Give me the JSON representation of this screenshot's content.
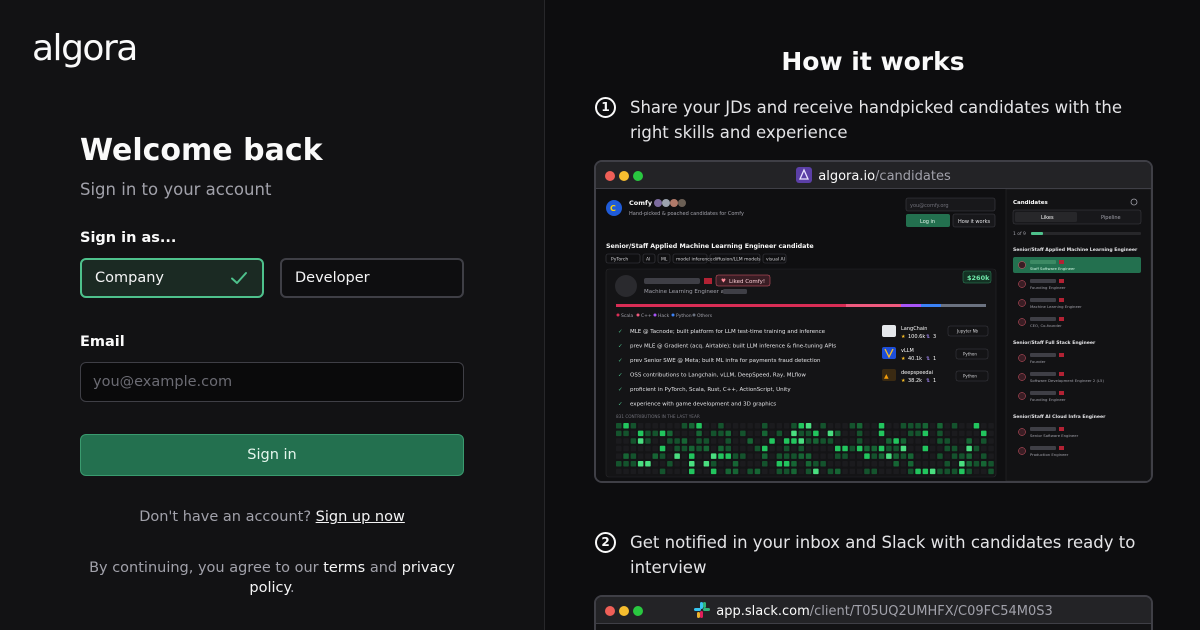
{
  "brand": {
    "logo_text": "algora"
  },
  "signin": {
    "title": "Welcome back",
    "subtitle": "Sign in to your account",
    "signin_as_label": "Sign in as...",
    "roles": [
      {
        "label": "Company",
        "selected": true
      },
      {
        "label": "Developer",
        "selected": false
      }
    ],
    "email_label": "Email",
    "email_placeholder": "you@example.com",
    "email_value": "",
    "submit_label": "Sign in",
    "no_account_text": "Don't have an account?",
    "signup_link": "Sign up now",
    "terms_prefix": "By continuing, you agree to our",
    "terms_link": "terms",
    "terms_and": "and",
    "privacy_link": "privacy policy",
    "terms_suffix": "."
  },
  "how_it_works": {
    "title": "How it works",
    "steps": [
      {
        "num": "1",
        "text": "Share your JDs and receive handpicked candidates with the right skills and experience"
      },
      {
        "num": "2",
        "text": "Get notified in your inbox and Slack with candidates ready to interview"
      }
    ],
    "browser1": {
      "url_host": "algora.io",
      "url_path": "/candidates",
      "company_name": "Comfy",
      "company_tagline": "Hand-picked & poached candidates for Comfy",
      "email_placeholder": "you@comfy.org",
      "login_label": "Log in",
      "how_label": "How it works",
      "job_title": "Senior/Staff Applied Machine Learning Engineer candidate",
      "tags": [
        "PyTorch",
        "AI",
        "ML",
        "model inference",
        "diffusion/LLM models",
        "visual AI"
      ],
      "candidate_role": "Machine Learning Engineer at",
      "liked_badge": "Liked Comfy!",
      "salary": "$260k",
      "languages": [
        "Scala",
        "C++",
        "Hack",
        "Python",
        "Others"
      ],
      "highlights": [
        "MLE @ Tacnode; built platform for LLM test-time training and inference",
        "prev MLE @ Gradient (acq. Airtable); built LLM inference & fine-tuning APIs",
        "prev Senior SWE @ Meta; built ML infra for payments fraud detection",
        "OSS contributions to Langchain, vLLM, DeepSpeed, Ray, MLflow",
        "proficient in PyTorch, Scala, Rust, C++, ActionScript, Unity",
        "experience with game development and 3D graphics"
      ],
      "repos": [
        {
          "name": "LangChain",
          "stars": "100.6k",
          "prs": "3",
          "lang": "Jupyter Nb"
        },
        {
          "name": "vLLM",
          "stars": "40.1k",
          "prs": "1",
          "lang": "Python"
        },
        {
          "name": "deepspeedai",
          "stars": "38.2k",
          "prs": "1",
          "lang": "Python"
        }
      ],
      "contrib_label": "831 CONTRIBUTIONS IN THE LAST YEAR",
      "sidebar_title": "Candidates",
      "sidebar_tabs": [
        "Likes",
        "Pipeline"
      ],
      "sidebar_count": "1 of 9",
      "groups": [
        {
          "title": "Senior/Staff Applied Machine Learning Engineer",
          "roles": [
            "Staff Software Engineer",
            "Founding Engineer",
            "Machine Learning Engineer",
            "CEO, Co-founder"
          ]
        },
        {
          "title": "Senior/Staff Full Stack Engineer",
          "roles": [
            "Founder",
            "Software Development Engineer 2 (L5)",
            "Founding Engineer"
          ]
        },
        {
          "title": "Senior/Staff AI Cloud Infra Engineer",
          "roles": [
            "Senior Software Engineer",
            "Production Engineer"
          ]
        }
      ]
    },
    "browser2": {
      "url_host": "app.slack.com",
      "url_path": "/client/T05UQ2UMHFX/C09FC54M0S3"
    }
  },
  "colors": {
    "accent": "#4ec18c",
    "button_bg": "#23704f",
    "dot_red": "#ef5f57",
    "dot_yellow": "#f6bd2f",
    "dot_green": "#29c840"
  }
}
